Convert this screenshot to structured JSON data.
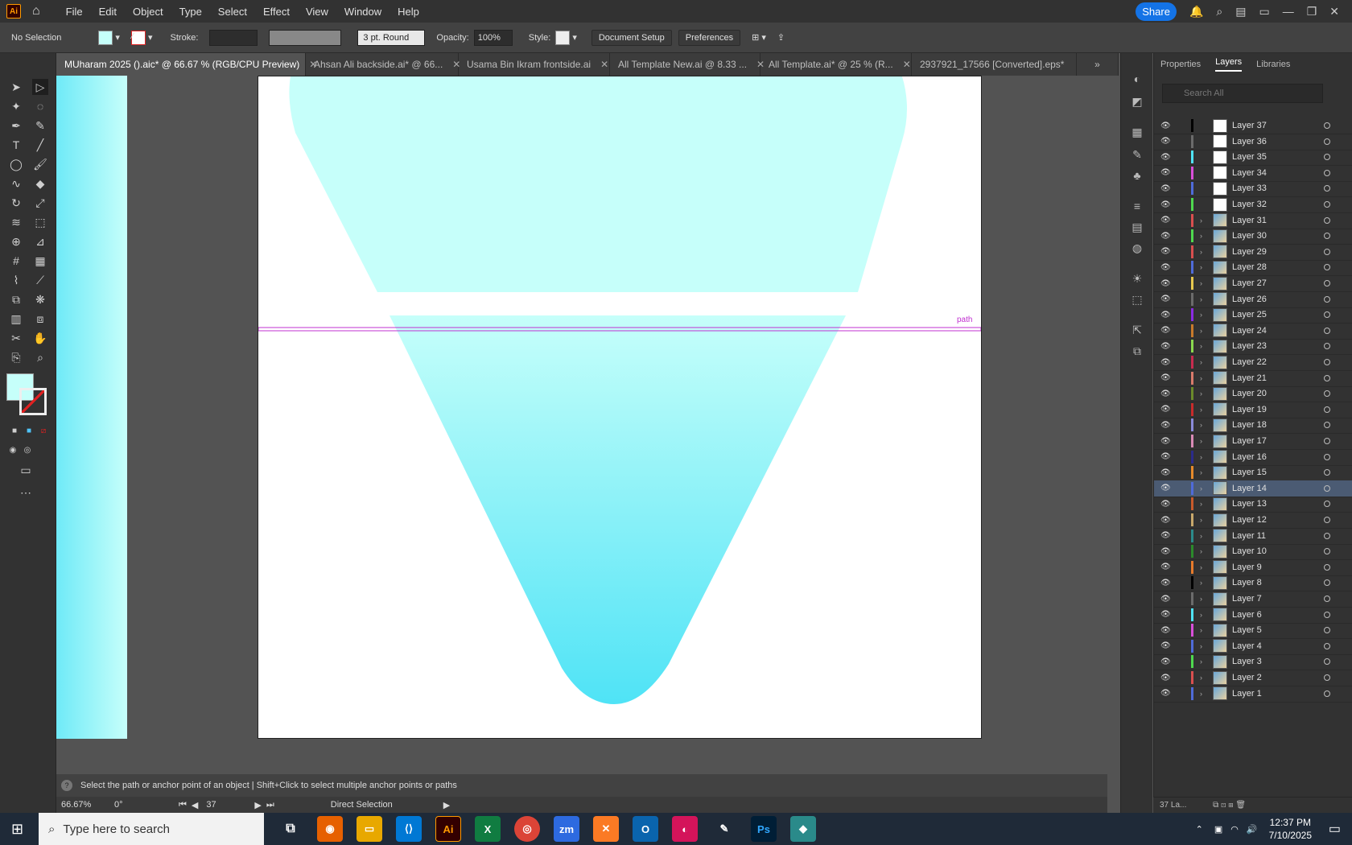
{
  "app": {
    "logo": "Ai",
    "menus": [
      "File",
      "Edit",
      "Object",
      "Type",
      "Select",
      "Effect",
      "View",
      "Window",
      "Help"
    ],
    "share_label": "Share"
  },
  "control": {
    "selection": "No Selection",
    "stroke_label": "Stroke:",
    "brush": "3 pt. Round",
    "opacity_label": "Opacity:",
    "opacity_value": "100%",
    "style_label": "Style:",
    "doc_setup": "Document Setup",
    "preferences": "Preferences",
    "fill_color": "#c6fffa"
  },
  "tabs": [
    {
      "label": "MUharam 2025 ().aic* @ 66.67 % (RGB/CPU Preview)",
      "active": true
    },
    {
      "label": "Ahsan Ali backside.ai* @ 66..."
    },
    {
      "label": "Usama Bin Ikram frontside.ai"
    },
    {
      "label": "All Template New.ai @ 8.33 ..."
    },
    {
      "label": "All Template.ai* @ 25 % (R..."
    },
    {
      "label": "2937921_17566 [Converted].eps*"
    }
  ],
  "canvas": {
    "path_label": "path",
    "top_shape_color": "#c6fffa",
    "bottom_gradient": [
      "#c6fffa",
      "#4fe3f6"
    ]
  },
  "panel": {
    "tabs": [
      "Properties",
      "Layers",
      "Libraries"
    ],
    "search_placeholder": "Search All",
    "footer": "37 La..."
  },
  "layers": [
    {
      "name": "Layer 37",
      "color": "#000000",
      "thumb": false
    },
    {
      "name": "Layer 36",
      "color": "#6b6b6b",
      "thumb": false
    },
    {
      "name": "Layer 35",
      "color": "#4fe3f6",
      "thumb": false
    },
    {
      "name": "Layer 34",
      "color": "#d94fd9",
      "thumb": false
    },
    {
      "name": "Layer 33",
      "color": "#4f6bd9",
      "thumb": false
    },
    {
      "name": "Layer 32",
      "color": "#4fd94f",
      "thumb": false
    },
    {
      "name": "Layer 31",
      "color": "#d94f4f",
      "thumb": true
    },
    {
      "name": "Layer 30",
      "color": "#4fd94f",
      "thumb": true
    },
    {
      "name": "Layer 29",
      "color": "#d94f4f",
      "thumb": true
    },
    {
      "name": "Layer 28",
      "color": "#4f6bd9",
      "thumb": true
    },
    {
      "name": "Layer 27",
      "color": "#e6c84f",
      "thumb": true
    },
    {
      "name": "Layer 26",
      "color": "#6b6b6b",
      "thumb": true
    },
    {
      "name": "Layer 25",
      "color": "#8a2be2",
      "thumb": true
    },
    {
      "name": "Layer 24",
      "color": "#c87a2b",
      "thumb": true
    },
    {
      "name": "Layer 23",
      "color": "#8ad94f",
      "thumb": true
    },
    {
      "name": "Layer 22",
      "color": "#c82b4f",
      "thumb": true
    },
    {
      "name": "Layer 21",
      "color": "#d97a6b",
      "thumb": true
    },
    {
      "name": "Layer 20",
      "color": "#6b8a2b",
      "thumb": true
    },
    {
      "name": "Layer 19",
      "color": "#c82b2b",
      "thumb": true
    },
    {
      "name": "Layer 18",
      "color": "#8a8ad9",
      "thumb": true
    },
    {
      "name": "Layer 17",
      "color": "#d98ab5",
      "thumb": true
    },
    {
      "name": "Layer 16",
      "color": "#2b2b8a",
      "thumb": true
    },
    {
      "name": "Layer 15",
      "color": "#e68a2b",
      "thumb": true
    },
    {
      "name": "Layer 14",
      "color": "#4f6bd9",
      "thumb": true,
      "selected": true
    },
    {
      "name": "Layer 13",
      "color": "#c85a2b",
      "thumb": true
    },
    {
      "name": "Layer 12",
      "color": "#c8a86b",
      "thumb": true
    },
    {
      "name": "Layer 11",
      "color": "#2b8a8a",
      "thumb": true
    },
    {
      "name": "Layer 10",
      "color": "#2b8a2b",
      "thumb": true
    },
    {
      "name": "Layer 9",
      "color": "#e67a2b",
      "thumb": true
    },
    {
      "name": "Layer 8",
      "color": "#000000",
      "thumb": true
    },
    {
      "name": "Layer 7",
      "color": "#6b6b6b",
      "thumb": true
    },
    {
      "name": "Layer 6",
      "color": "#4fe3f6",
      "thumb": true
    },
    {
      "name": "Layer 5",
      "color": "#d94fd9",
      "thumb": true
    },
    {
      "name": "Layer 4",
      "color": "#4f6bd9",
      "thumb": true
    },
    {
      "name": "Layer 3",
      "color": "#4fd94f",
      "thumb": true
    },
    {
      "name": "Layer 2",
      "color": "#d94f4f",
      "thumb": true
    },
    {
      "name": "Layer 1",
      "color": "#4f6bd9",
      "thumb": true
    }
  ],
  "status": {
    "hint": "Select the path or anchor point of an object  |  Shift+Click to select multiple anchor points or paths",
    "zoom": "66.67%",
    "rotation": "0°",
    "artboard": "37",
    "tool": "Direct Selection"
  },
  "taskbar": {
    "search_placeholder": "Type here to search",
    "time": "12:37 PM",
    "date": "7/10/2025"
  }
}
